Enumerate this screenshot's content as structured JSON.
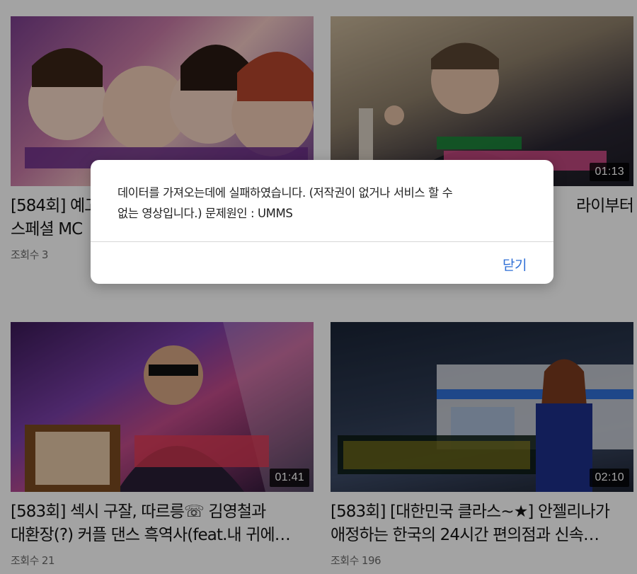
{
  "cards": [
    {
      "title_lines": [
        "[584회] 예고",
        "스페셜 MC"
      ],
      "views_label": "조회수",
      "views": "3",
      "duration": ""
    },
    {
      "title_lines": [
        "",
        "라이부터"
      ],
      "views_label": "",
      "views": "",
      "duration": "01:13"
    },
    {
      "title_lines": [
        "[583회] 섹시 구잘, 따르릉☏ 김영철과",
        "대환장(?) 커플 댄스 흑역사(feat.내 귀에…"
      ],
      "views_label": "조회수",
      "views": "21",
      "duration": "01:41"
    },
    {
      "title_lines": [
        "[583회] [대한민국 클라스~★] 안젤리나가",
        "애정하는 한국의 24시간 편의점과 신속…"
      ],
      "views_label": "조회수",
      "views": "196",
      "duration": "02:10"
    }
  ],
  "dialog": {
    "message_line1": "데이터를 가져오는데에 실패하였습니다. (저작권이 없거나 서비스 할 수",
    "message_line2": "없는 영상입니다.) 문제원인 : UMMS",
    "close_label": "닫기"
  },
  "colors": {
    "overlay": "rgba(0,0,0,0.36)",
    "accent": "#2f6fd6",
    "duration_bg": "rgba(0,0,0,0.78)"
  }
}
